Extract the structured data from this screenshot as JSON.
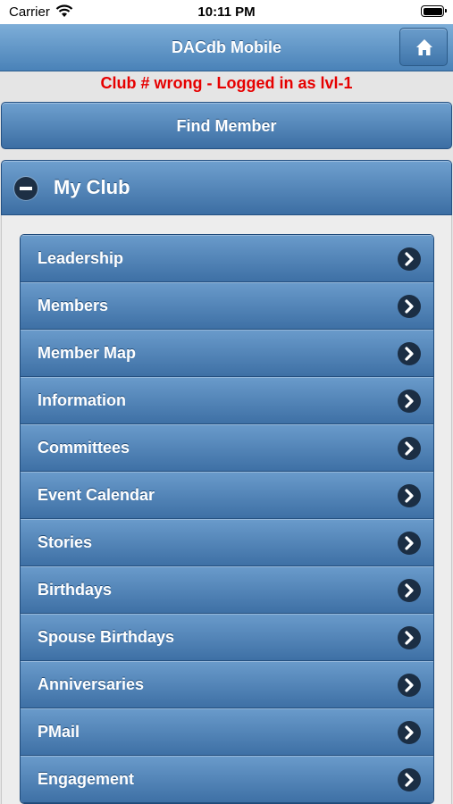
{
  "status_bar": {
    "carrier": "Carrier",
    "time": "10:11 PM"
  },
  "header": {
    "title": "DACdb Mobile",
    "home_icon": "home-icon"
  },
  "warning": {
    "text": "Club # wrong - Logged in as lvl-1",
    "color": "#e60000"
  },
  "find_member": {
    "label": "Find Member"
  },
  "my_club": {
    "label": "My Club",
    "expanded": true,
    "items": [
      {
        "label": "Leadership"
      },
      {
        "label": "Members"
      },
      {
        "label": "Member Map"
      },
      {
        "label": "Information"
      },
      {
        "label": "Committees"
      },
      {
        "label": "Event Calendar"
      },
      {
        "label": "Stories"
      },
      {
        "label": "Birthdays"
      },
      {
        "label": "Spouse Birthdays"
      },
      {
        "label": "Anniversaries"
      },
      {
        "label": "PMail"
      },
      {
        "label": "Engagement"
      }
    ]
  },
  "colors": {
    "accent": "#4a82b8",
    "button": "#3e70a5"
  }
}
